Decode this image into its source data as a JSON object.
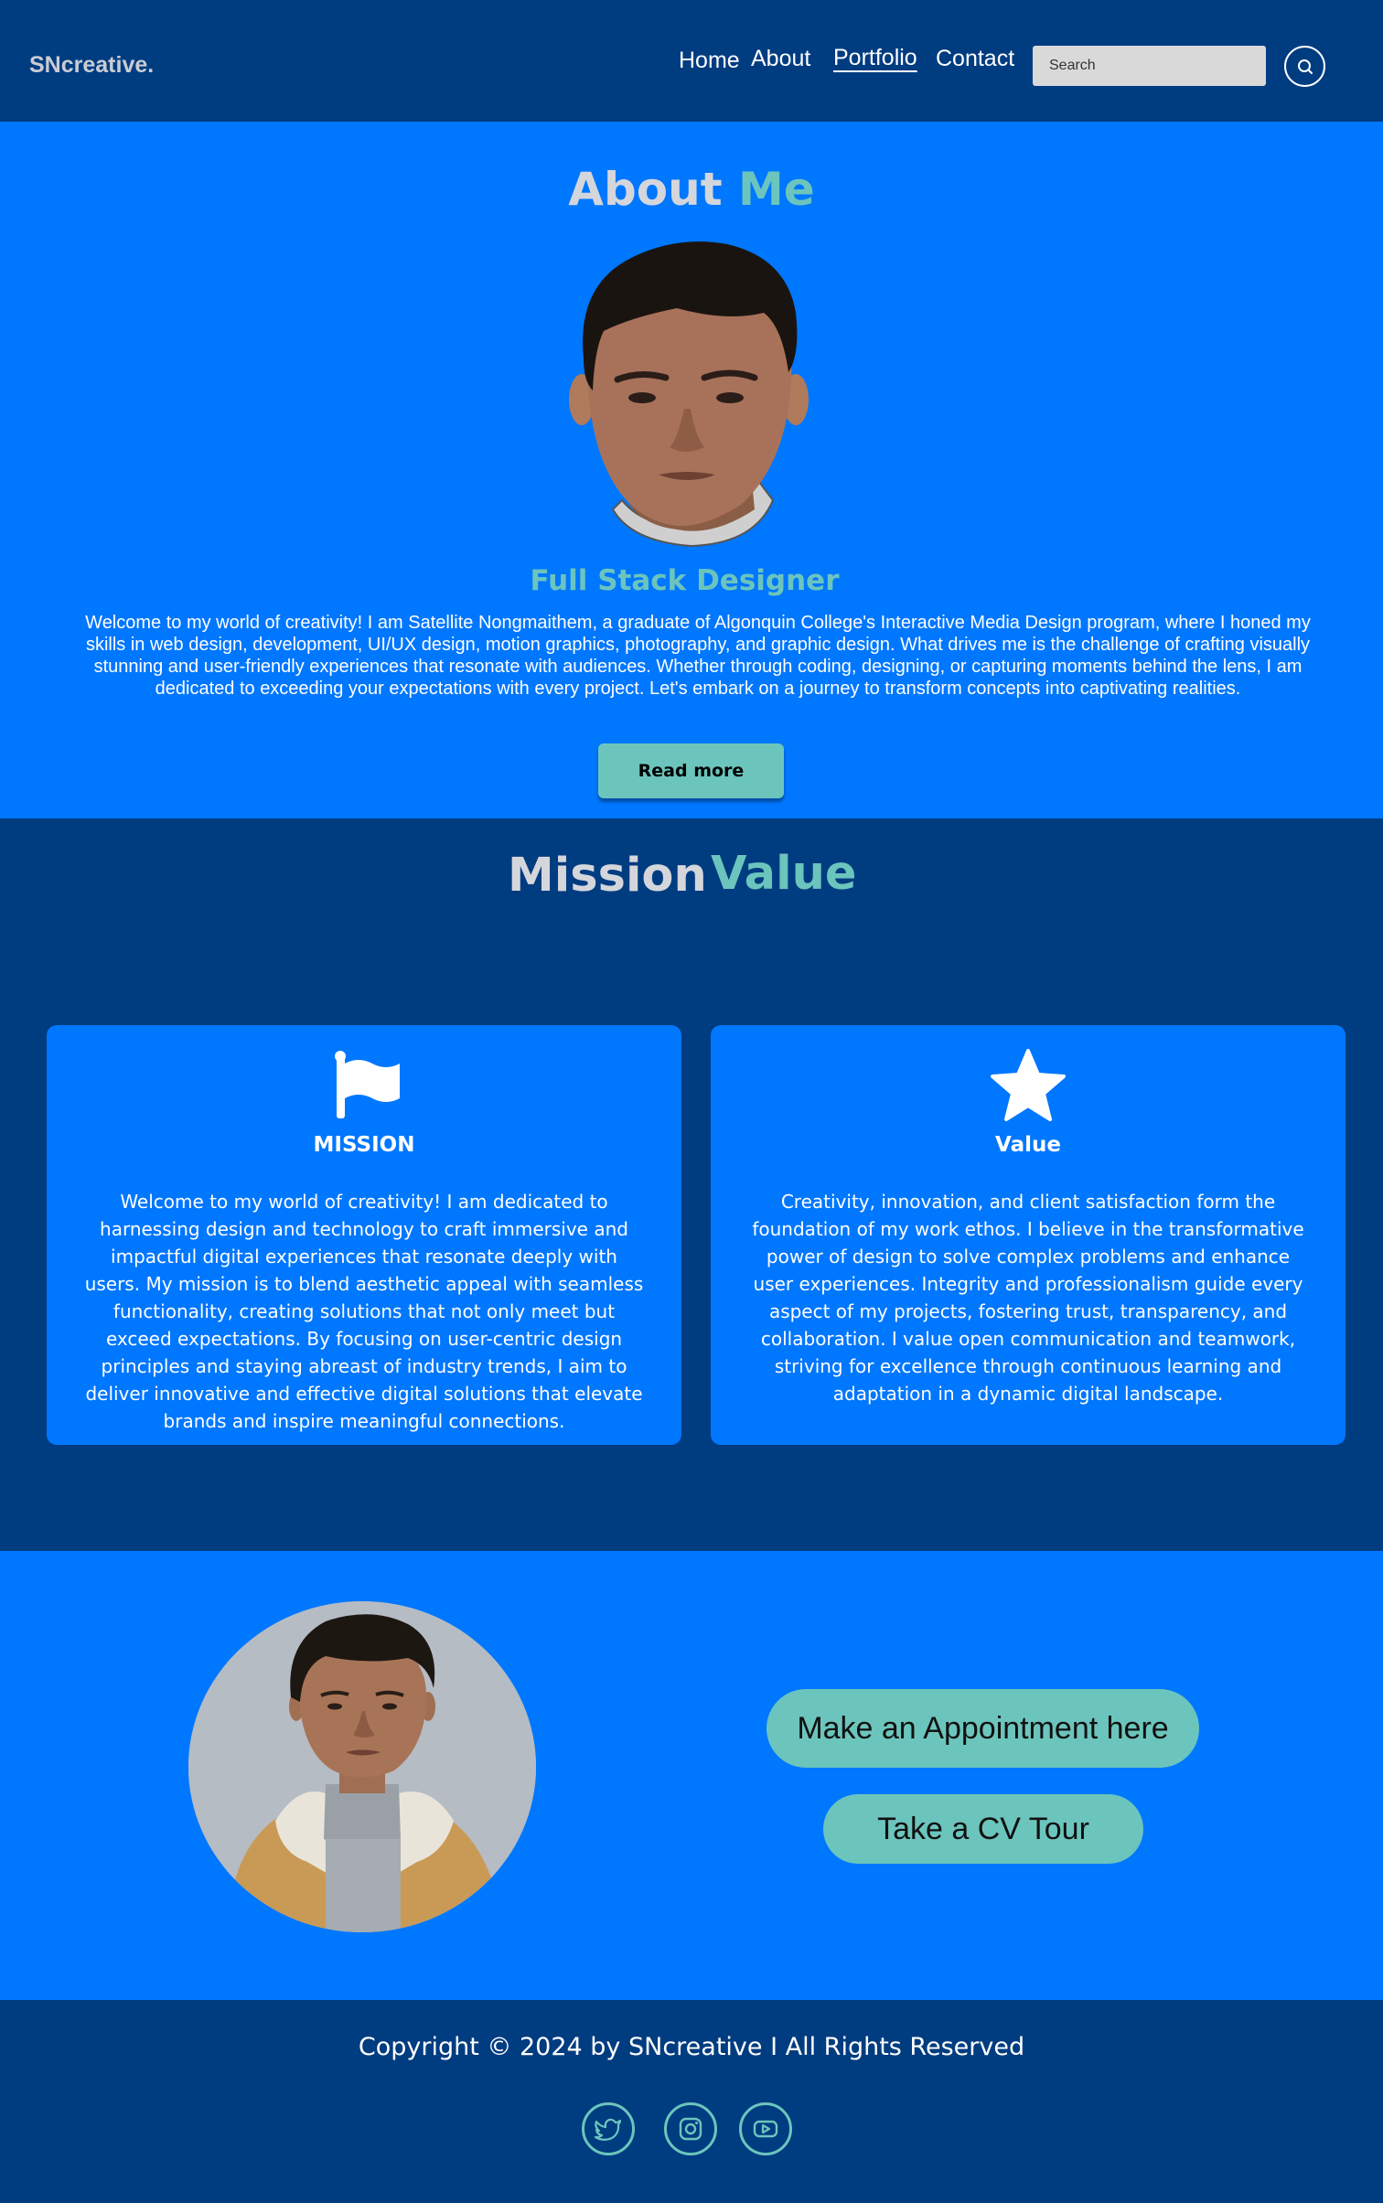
{
  "header": {
    "logo": "SNcreative.",
    "nav": [
      "Home",
      "About",
      "Portfolio",
      "Contact"
    ],
    "active_nav": "Portfolio",
    "search_placeholder": "Search"
  },
  "about": {
    "title_part1": "About",
    "title_part2": "Me",
    "role": "Full Stack Designer",
    "text": "Welcome to my world of creativity! I am Satellite Nongmaithem, a graduate of Algonquin College's Interactive Media Design program, where I honed my skills in web design, development, UI/UX design, motion graphics, photography, and graphic design. What drives me is the challenge of crafting visually stunning and user-friendly experiences that resonate with audiences. Whether through coding, designing, or capturing moments behind the lens, I am dedicated to exceeding your expectations with every project. Let's embark on a journey to transform concepts into captivating realities.",
    "button": "Read more"
  },
  "mission_value": {
    "title_part1": "Mission",
    "title_part2": "Value",
    "cards": [
      {
        "icon": "flag-icon",
        "title": "MISSION",
        "text": "Welcome to my world of creativity! I am dedicated to harnessing design and technology to craft immersive and impactful digital experiences that resonate deeply with users. My mission is to blend aesthetic appeal with seamless functionality, creating solutions that not only meet but exceed expectations. By focusing on user-centric design principles and staying abreast of industry trends, I aim to deliver innovative and effective digital solutions that elevate brands and inspire meaningful connections."
      },
      {
        "icon": "star-icon",
        "title": "Value",
        "text": "Creativity, innovation, and client satisfaction form the foundation of my work ethos. I believe in the transformative power of design to solve complex problems and enhance user experiences. Integrity and professionalism guide every aspect of my projects, fostering trust, transparency, and collaboration. I value open communication and teamwork, striving for excellence through continuous learning and adaptation in a dynamic digital landscape."
      }
    ]
  },
  "appointment": {
    "button1": "Make an Appointment here",
    "button2": "Take a  CV Tour"
  },
  "footer": {
    "copyright": "Copyright © 2024 by SNcreative I All Rights Reserved",
    "social": [
      "twitter-icon",
      "instagram-icon",
      "youtube-icon"
    ]
  },
  "colors": {
    "navy": "#003c80",
    "blue": "#0077ff",
    "teal": "#6cc5bd",
    "light_gray": "#d4d6dc"
  }
}
